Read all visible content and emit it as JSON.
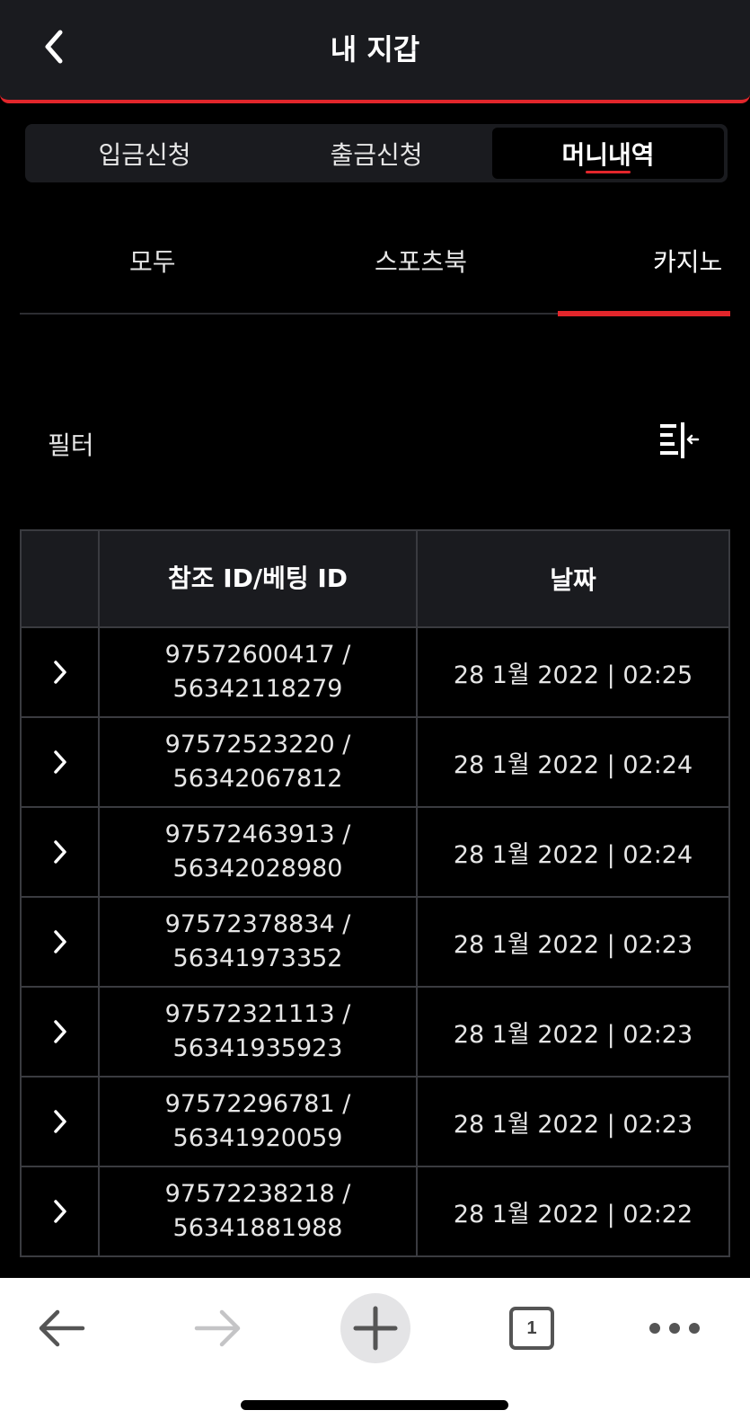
{
  "header": {
    "title": "내 지갑",
    "back_icon": "chevron-left-icon"
  },
  "segment": [
    {
      "label": "입금신청",
      "active": false
    },
    {
      "label": "출금신청",
      "active": false
    },
    {
      "label": "머니내역",
      "active": true
    }
  ],
  "tabs": [
    {
      "label": "모두",
      "active": false
    },
    {
      "label": "스포츠북",
      "active": false
    },
    {
      "label": "카지노",
      "active": true
    }
  ],
  "filter": {
    "label": "필터",
    "icon": "sort-filter-icon"
  },
  "table": {
    "headers": [
      "",
      "참조 ID/베팅 ID",
      "날짜"
    ],
    "rows": [
      {
        "ref_id": "97572600417 /",
        "bet_id": "56342118279",
        "date": "28 1월 2022 | 02:25"
      },
      {
        "ref_id": "97572523220 /",
        "bet_id": "56342067812",
        "date": "28 1월 2022 | 02:24"
      },
      {
        "ref_id": "97572463913 /",
        "bet_id": "56342028980",
        "date": "28 1월 2022 | 02:24"
      },
      {
        "ref_id": "97572378834 /",
        "bet_id": "56341973352",
        "date": "28 1월 2022 | 02:23"
      },
      {
        "ref_id": "97572321113 /",
        "bet_id": "56341935923",
        "date": "28 1월 2022 | 02:23"
      },
      {
        "ref_id": "97572296781 /",
        "bet_id": "56341920059",
        "date": "28 1월 2022 | 02:23"
      },
      {
        "ref_id": "97572238218 /",
        "bet_id": "56341881988",
        "date": "28 1월 2022 | 02:22"
      }
    ]
  },
  "browser_bar": {
    "tab_count": "1"
  },
  "colors": {
    "accent": "#e2262b",
    "background": "#000000",
    "panel": "#1a1b1f",
    "border": "#3a3b40"
  }
}
